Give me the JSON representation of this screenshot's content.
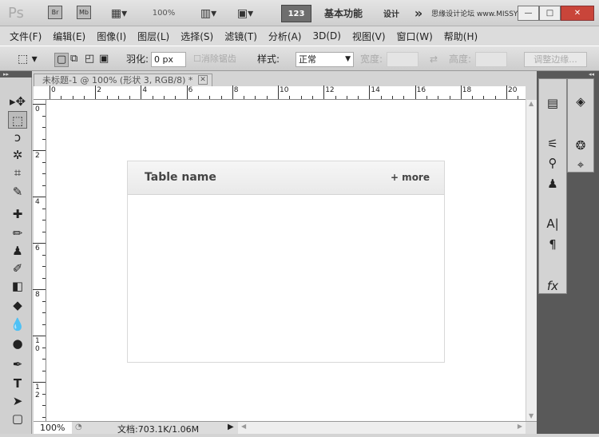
{
  "titlebar": {
    "logo": "Ps",
    "bridge": "Br",
    "minibridge": "Mb",
    "zoom": "100%",
    "badge": "123",
    "workspace": "基本功能",
    "design": "设计",
    "more": "»",
    "watermark": "思缘设计论坛 www.MISSYUAN.COM"
  },
  "menu": [
    "文件(F)",
    "编辑(E)",
    "图像(I)",
    "图层(L)",
    "选择(S)",
    "滤镜(T)",
    "分析(A)",
    "3D(D)",
    "视图(V)",
    "窗口(W)",
    "帮助(H)"
  ],
  "options": {
    "feather_label": "羽化:",
    "feather_value": "0 px",
    "antialias_label": "消除锯齿",
    "style_label": "样式:",
    "style_value": "正常",
    "width_label": "宽度:",
    "height_label": "高度:",
    "refine_button": "调整边缘..."
  },
  "document": {
    "tab_title": "未标题-1 @ 100% (形状 3, RGB/8) *",
    "close": "✕"
  },
  "rulers": {
    "horizontal": [
      "0",
      "2",
      "4",
      "6",
      "8",
      "10",
      "12",
      "14",
      "16",
      "18",
      "20"
    ],
    "vertical": [
      "0",
      "2",
      "4",
      "6",
      "8",
      "10",
      "12"
    ]
  },
  "card": {
    "title": "Table name",
    "more": "+ more"
  },
  "status": {
    "zoom": "100%",
    "doc": "文档:703.1K/1.06M"
  },
  "colors": {
    "accent_badge": "#6e6e6e",
    "close_button": "#c9453a"
  }
}
